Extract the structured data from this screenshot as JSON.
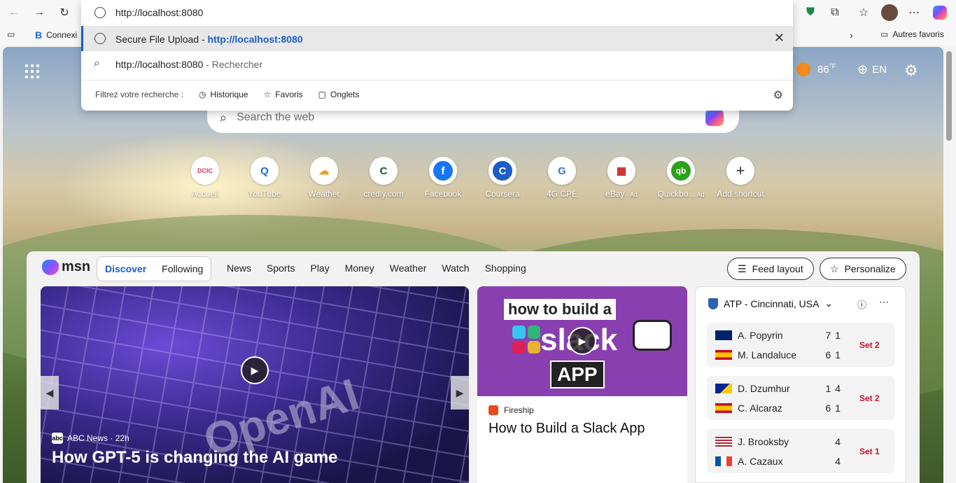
{
  "browser": {
    "address_url": "http://localhost:8080",
    "omnibox": {
      "suggestion_title": "Secure File Upload",
      "suggestion_sep": " - ",
      "suggestion_url": "http://localhost:8080",
      "search_query": "http://localhost:8080",
      "search_suffix": " - Rechercher",
      "filter_label": "Filtrez votre recherche :",
      "filters": [
        "Historique",
        "Favoris",
        "Onglets"
      ]
    },
    "favorites": {
      "first_item": "Connexi",
      "other_favorites": "Autres favoris"
    }
  },
  "ntp": {
    "weather_temp": "86",
    "weather_unit": "°F",
    "language": "EN",
    "search_placeholder": "Search the web",
    "shortcuts": [
      {
        "label": "Accueil",
        "glyph": "DCIC",
        "color": "#d4356a"
      },
      {
        "label": "YouTube",
        "glyph": "Q",
        "color": "#1b6fd6"
      },
      {
        "label": "Weather",
        "glyph": "☁",
        "color": "#f0a020"
      },
      {
        "label": "credly.com",
        "glyph": "C",
        "color": "#0f5c3f"
      },
      {
        "label": "Facebook",
        "glyph": "f",
        "color": "#1877f2"
      },
      {
        "label": "Coursera",
        "glyph": "C",
        "color": "#1b5dc9"
      },
      {
        "label": "4G CPE",
        "glyph": "G",
        "color": "#3a7bd5"
      },
      {
        "label": "eBay",
        "glyph": "▦",
        "color": "#c71e1e",
        "ad": "Ad"
      },
      {
        "label": "Quickbo...",
        "glyph": "qb",
        "color": "#2ca01c",
        "ad": "Ad"
      },
      {
        "label": "Add shortcut",
        "glyph": "+",
        "color": "#333333"
      }
    ]
  },
  "feed": {
    "brand": "msn",
    "tabs": [
      "Discover",
      "Following"
    ],
    "nav": [
      "News",
      "Sports",
      "Play",
      "Money",
      "Weather",
      "Watch",
      "Shopping"
    ],
    "feed_layout": "Feed layout",
    "personalize": "Personalize",
    "hero": {
      "source": "ABC News",
      "age": "22h",
      "title": "How GPT-5 is changing the AI game",
      "overlay_text": "OpenAI"
    },
    "card2": {
      "img_line1": "how to build a",
      "img_line2": "slack",
      "img_line3": "APP",
      "source": "Fireship",
      "title": "How to Build a Slack App"
    },
    "atp": {
      "title": "ATP - Cincinnati, USA",
      "matches": [
        {
          "p1": "A. Popyrin",
          "s1": "7 1",
          "p2": "M. Landaluce",
          "s2": "6 1",
          "set": "Set 2"
        },
        {
          "p1": "D. Dzumhur",
          "s1": "1 4",
          "p2": "C. Alcaraz",
          "s2": "6 1",
          "set": "Set 2"
        },
        {
          "p1": "J. Brooksby",
          "s1": "4",
          "p2": "A. Cazaux",
          "s2": "4",
          "set": "Set 1"
        }
      ]
    }
  }
}
